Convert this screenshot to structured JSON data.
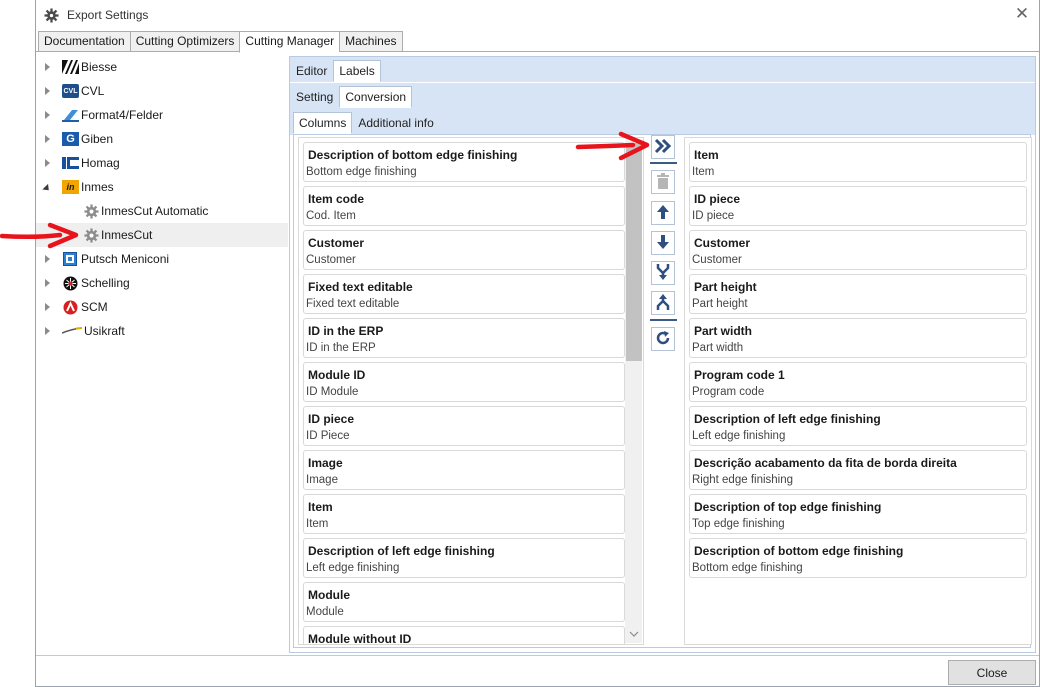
{
  "window": {
    "title": "Export Settings"
  },
  "top_tabs": [
    "Documentation",
    "Cutting Optimizers",
    "Cutting Manager",
    "Machines"
  ],
  "tree": [
    {
      "label": "Biesse",
      "logo": "biesse-logo"
    },
    {
      "label": "CVL",
      "logo": "cvl-logo",
      "logo_text": "CVL"
    },
    {
      "label": "Format4/Felder",
      "logo": "format4-logo"
    },
    {
      "label": "Giben",
      "logo": "giben-logo",
      "logo_text": "G"
    },
    {
      "label": "Homag",
      "logo": "homag-logo"
    },
    {
      "label": "Inmes",
      "logo": "inmes-logo",
      "logo_text": "in"
    },
    {
      "label": "InmesCut Automatic",
      "logo": "gear-icon"
    },
    {
      "label": "InmesCut",
      "logo": "gear-icon"
    },
    {
      "label": "Putsch Meniconi",
      "logo": "putsch-logo"
    },
    {
      "label": "Schelling",
      "logo": "schelling-logo"
    },
    {
      "label": "SCM",
      "logo": "scm-logo"
    },
    {
      "label": "Usikraft",
      "logo": "usikraft-logo"
    }
  ],
  "level1_tabs": [
    "Editor",
    "Labels"
  ],
  "level2_tabs": [
    "Setting",
    "Conversion"
  ],
  "level3_tabs": [
    "Columns",
    "Additional info"
  ],
  "available_columns": [
    {
      "title": "Description of bottom edge finishing",
      "subtitle": "Bottom edge finishing"
    },
    {
      "title": "Item code",
      "subtitle": "Cod. Item"
    },
    {
      "title": "Customer",
      "subtitle": "Customer"
    },
    {
      "title": "Fixed text editable",
      "subtitle": "Fixed text editable"
    },
    {
      "title": "ID in the ERP",
      "subtitle": "ID in the ERP"
    },
    {
      "title": "Module ID",
      "subtitle": "ID Module"
    },
    {
      "title": "ID piece",
      "subtitle": "ID Piece"
    },
    {
      "title": "Image",
      "subtitle": "Image"
    },
    {
      "title": "Item",
      "subtitle": "Item"
    },
    {
      "title": "Description of left edge finishing",
      "subtitle": "Left edge finishing"
    },
    {
      "title": "Module",
      "subtitle": "Module"
    },
    {
      "title": "Module without ID",
      "subtitle": ""
    }
  ],
  "selected_columns": [
    {
      "title": "Item",
      "subtitle": "Item"
    },
    {
      "title": "ID piece",
      "subtitle": "ID piece"
    },
    {
      "title": "Customer",
      "subtitle": "Customer"
    },
    {
      "title": "Part height",
      "subtitle": "Part height"
    },
    {
      "title": "Part width",
      "subtitle": "Part width"
    },
    {
      "title": "Program code 1",
      "subtitle": "Program code"
    },
    {
      "title": "Description of left edge finishing",
      "subtitle": "Left edge finishing"
    },
    {
      "title": "Descrição acabamento da fita de borda direita",
      "subtitle": "Right edge finishing"
    },
    {
      "title": "Description of top edge finishing",
      "subtitle": "Top edge finishing"
    },
    {
      "title": "Description of bottom edge finishing",
      "subtitle": "Bottom edge finishing"
    }
  ],
  "toolbar": [
    {
      "name": "add-all-button",
      "icon": "double-chevron-right-icon",
      "enabled": true
    },
    {
      "name": "delete-button",
      "icon": "trash-icon",
      "enabled": false
    },
    {
      "name": "move-up-button",
      "icon": "arrow-up-icon",
      "enabled": true
    },
    {
      "name": "move-down-button",
      "icon": "arrow-down-icon",
      "enabled": true
    },
    {
      "name": "merge-button",
      "icon": "merge-icon",
      "enabled": true
    },
    {
      "name": "split-button",
      "icon": "split-icon",
      "enabled": true
    },
    {
      "name": "reset-button",
      "icon": "refresh-icon",
      "enabled": true
    }
  ],
  "footer": {
    "close_label": "Close"
  },
  "colors": {
    "accent": "#3b5a8a",
    "panel_bg": "#d6e4f5",
    "annotation": "#e8141b"
  }
}
